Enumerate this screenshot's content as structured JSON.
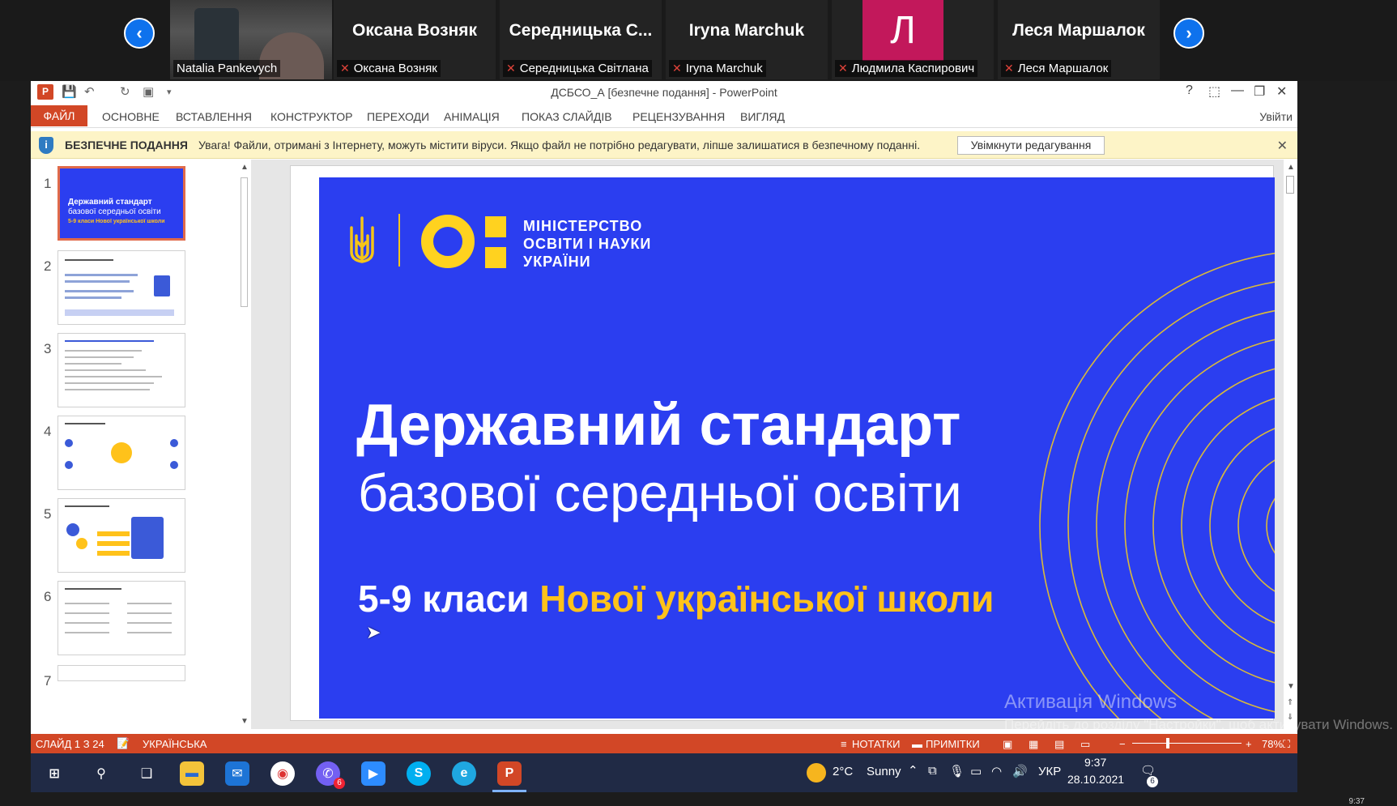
{
  "zoom": {
    "participants": [
      {
        "display": "",
        "label": "Natalia Pankevych",
        "type": "video",
        "muted": false
      },
      {
        "display": "Оксана Возняк",
        "label": "Оксана Возняк",
        "type": "name",
        "muted": true
      },
      {
        "display": "Середницька С...",
        "label": "Середницька Світлана",
        "type": "name",
        "muted": true
      },
      {
        "display": "Iryna Marchuk",
        "label": "Iryna Marchuk",
        "type": "name",
        "muted": true
      },
      {
        "display": "Л",
        "label": "Людмила Каспирович",
        "type": "avatar",
        "muted": true
      },
      {
        "display": "Леся Маршалок",
        "label": "Леся Маршалок",
        "type": "name",
        "muted": true
      }
    ],
    "prev_arrow": "‹",
    "next_arrow": "›"
  },
  "ppt": {
    "doc_title": "ДСБСО_А [безпечне подання] - PowerPoint",
    "app_icon": "P",
    "titlebar_buttons": [
      "?",
      "⬚",
      "—",
      "❐",
      "✕"
    ],
    "ribbon": {
      "file_tab": "ФАЙЛ",
      "tabs": [
        "ОСНОВНЕ",
        "ВСТАВЛЕННЯ",
        "КОНСТРУКТОР",
        "ПЕРЕХОДИ",
        "АНІМАЦІЯ",
        "ПОКАЗ СЛАЙДІВ",
        "РЕЦЕНЗУВАННЯ",
        "ВИГЛЯД"
      ],
      "signin": "Увійти"
    },
    "protected_view": {
      "title": "БЕЗПЕЧНЕ ПОДАННЯ",
      "message": "Увага! Файли, отримані з Інтернету, можуть містити віруси. Якщо файл не потрібно редагувати, ліпше залишатися в безпечному поданні.",
      "button": "Увімкнути редагування",
      "close": "✕"
    },
    "thumbnails": {
      "numbers": [
        "1",
        "2",
        "3",
        "4",
        "5",
        "6",
        "7"
      ],
      "thumb1_lines": [
        "Державний стандарт",
        "базової середньої освіти",
        "5-9 класи Нової української школи"
      ]
    },
    "slide": {
      "ministry_lines": [
        "МІНІСТЕРСТВО",
        "ОСВІТИ І НАУКИ",
        "УКРАЇНИ"
      ],
      "title_line1": "Державний стандарт",
      "title_line2": "базової середньої освіти",
      "subtitle_white": "5-9 класи ",
      "subtitle_yellow": "Нової української школи",
      "background_color": "#2b3ef0",
      "accent_color": "#ffc21a"
    },
    "watermark": {
      "title": "Активація Windows",
      "sub": "Перейдіть до розділу \"Настройки\", щоб активувати Windows."
    },
    "status": {
      "slide_info": "СЛАЙД 1 З 24",
      "language": "УКРАЇНСЬКА",
      "notes": "НОТАТКИ",
      "comments": "ПРИМІТКИ",
      "zoom": "78%"
    }
  },
  "taskbar": {
    "weather_temp": "2°C",
    "weather_desc": "Sunny",
    "lang": "УКР",
    "time": "9:37",
    "date": "28.10.2021",
    "notif_count": "6",
    "viber_badge": "6",
    "corner_time": "9:37"
  }
}
